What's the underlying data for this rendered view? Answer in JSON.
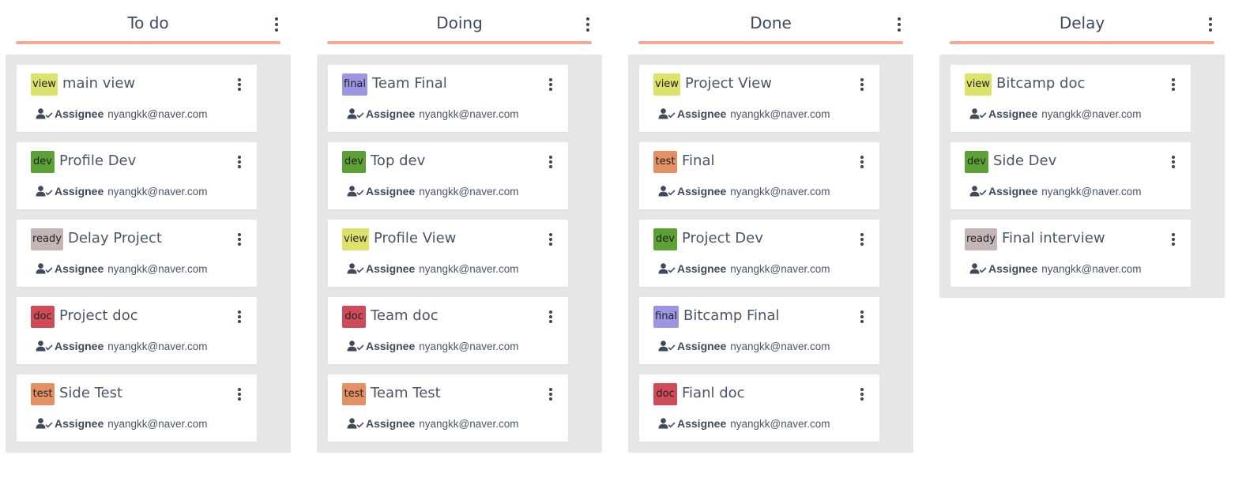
{
  "colors": {
    "underline": "#f3aa9a",
    "column_bg": "#e6e6e6",
    "tag_view": "#dde26a",
    "tag_dev": "#5ba134",
    "tag_ready": "#c4b6b8",
    "tag_doc": "#d04a58",
    "tag_test": "#e39062",
    "tag_final": "#9b95e2"
  },
  "icons": {
    "column_menu": "vertical-dots-icon",
    "card_menu": "vertical-dots-icon",
    "assignee": "user-check-icon"
  },
  "columns": [
    {
      "title": "To do",
      "cards": [
        {
          "tag": "view",
          "tag_color": "#dde26a",
          "title": "main view",
          "assignee_label": "Assignee",
          "assignee": "nyangkk@naver.com"
        },
        {
          "tag": "dev",
          "tag_color": "#5ba134",
          "title": "Profile Dev",
          "assignee_label": "Assignee",
          "assignee": "nyangkk@naver.com"
        },
        {
          "tag": "ready",
          "tag_color": "#c4b6b8",
          "title": "Delay Project",
          "assignee_label": "Assignee",
          "assignee": "nyangkk@naver.com"
        },
        {
          "tag": "doc",
          "tag_color": "#d04a58",
          "title": "Project doc",
          "assignee_label": "Assignee",
          "assignee": "nyangkk@naver.com"
        },
        {
          "tag": "test",
          "tag_color": "#e39062",
          "title": "Side Test",
          "assignee_label": "Assignee",
          "assignee": "nyangkk@naver.com"
        }
      ]
    },
    {
      "title": "Doing",
      "cards": [
        {
          "tag": "final",
          "tag_color": "#9b95e2",
          "title": "Team Final",
          "assignee_label": "Assignee",
          "assignee": "nyangkk@naver.com"
        },
        {
          "tag": "dev",
          "tag_color": "#5ba134",
          "title": "Top dev",
          "assignee_label": "Assignee",
          "assignee": "nyangkk@naver.com"
        },
        {
          "tag": "view",
          "tag_color": "#dde26a",
          "title": "Profile View",
          "assignee_label": "Assignee",
          "assignee": "nyangkk@naver.com"
        },
        {
          "tag": "doc",
          "tag_color": "#d04a58",
          "title": "Team doc",
          "assignee_label": "Assignee",
          "assignee": "nyangkk@naver.com"
        },
        {
          "tag": "test",
          "tag_color": "#e39062",
          "title": "Team Test",
          "assignee_label": "Assignee",
          "assignee": "nyangkk@naver.com"
        }
      ]
    },
    {
      "title": "Done",
      "cards": [
        {
          "tag": "view",
          "tag_color": "#dde26a",
          "title": "Project View",
          "assignee_label": "Assignee",
          "assignee": "nyangkk@naver.com"
        },
        {
          "tag": "test",
          "tag_color": "#e39062",
          "title": "Final",
          "assignee_label": "Assignee",
          "assignee": "nyangkk@naver.com"
        },
        {
          "tag": "dev",
          "tag_color": "#5ba134",
          "title": "Project Dev",
          "assignee_label": "Assignee",
          "assignee": "nyangkk@naver.com"
        },
        {
          "tag": "final",
          "tag_color": "#9b95e2",
          "title": "Bitcamp Final",
          "assignee_label": "Assignee",
          "assignee": "nyangkk@naver.com"
        },
        {
          "tag": "doc",
          "tag_color": "#d04a58",
          "title": "Fianl doc",
          "assignee_label": "Assignee",
          "assignee": "nyangkk@naver.com"
        }
      ]
    },
    {
      "title": "Delay",
      "cards": [
        {
          "tag": "view",
          "tag_color": "#dde26a",
          "title": "Bitcamp doc",
          "assignee_label": "Assignee",
          "assignee": "nyangkk@naver.com"
        },
        {
          "tag": "dev",
          "tag_color": "#5ba134",
          "title": "Side Dev",
          "assignee_label": "Assignee",
          "assignee": "nyangkk@naver.com"
        },
        {
          "tag": "ready",
          "tag_color": "#c4b6b8",
          "title": "Final interview",
          "assignee_label": "Assignee",
          "assignee": "nyangkk@naver.com"
        }
      ]
    }
  ]
}
